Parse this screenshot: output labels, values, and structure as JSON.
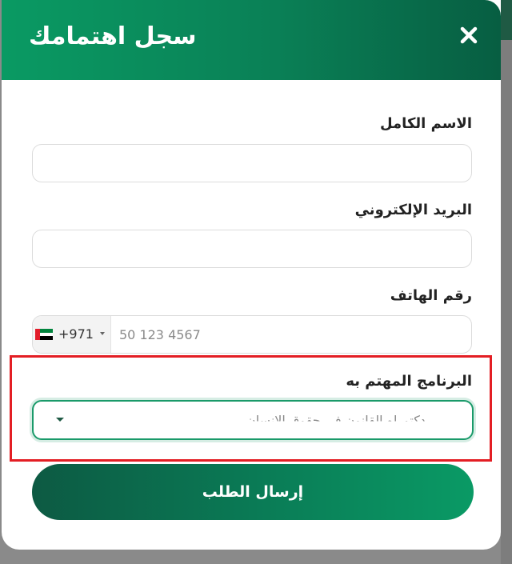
{
  "modal": {
    "title": "سجل اهتمامك",
    "close_icon": "close-icon"
  },
  "form": {
    "full_name": {
      "label": "الاسم الكامل",
      "value": "",
      "placeholder": ""
    },
    "email": {
      "label": "البريد الإلكتروني",
      "value": "",
      "placeholder": ""
    },
    "phone": {
      "label": "رقم الهاتف",
      "country_flag": "uae-flag-icon",
      "dial_code": "+971",
      "placeholder": "50 123 4567",
      "value": ""
    },
    "program": {
      "label": "البرنامج المهتم به",
      "selected": "دكتوراه القانون في حقوق الإنسان"
    },
    "submit_label": "إرسال الطلب"
  },
  "colors": {
    "brand_green": "#0a8056",
    "highlight_red": "#e31e24",
    "flag_red": "#e21c2a",
    "flag_green": "#00843d",
    "flag_white": "#ffffff",
    "flag_black": "#000000"
  }
}
